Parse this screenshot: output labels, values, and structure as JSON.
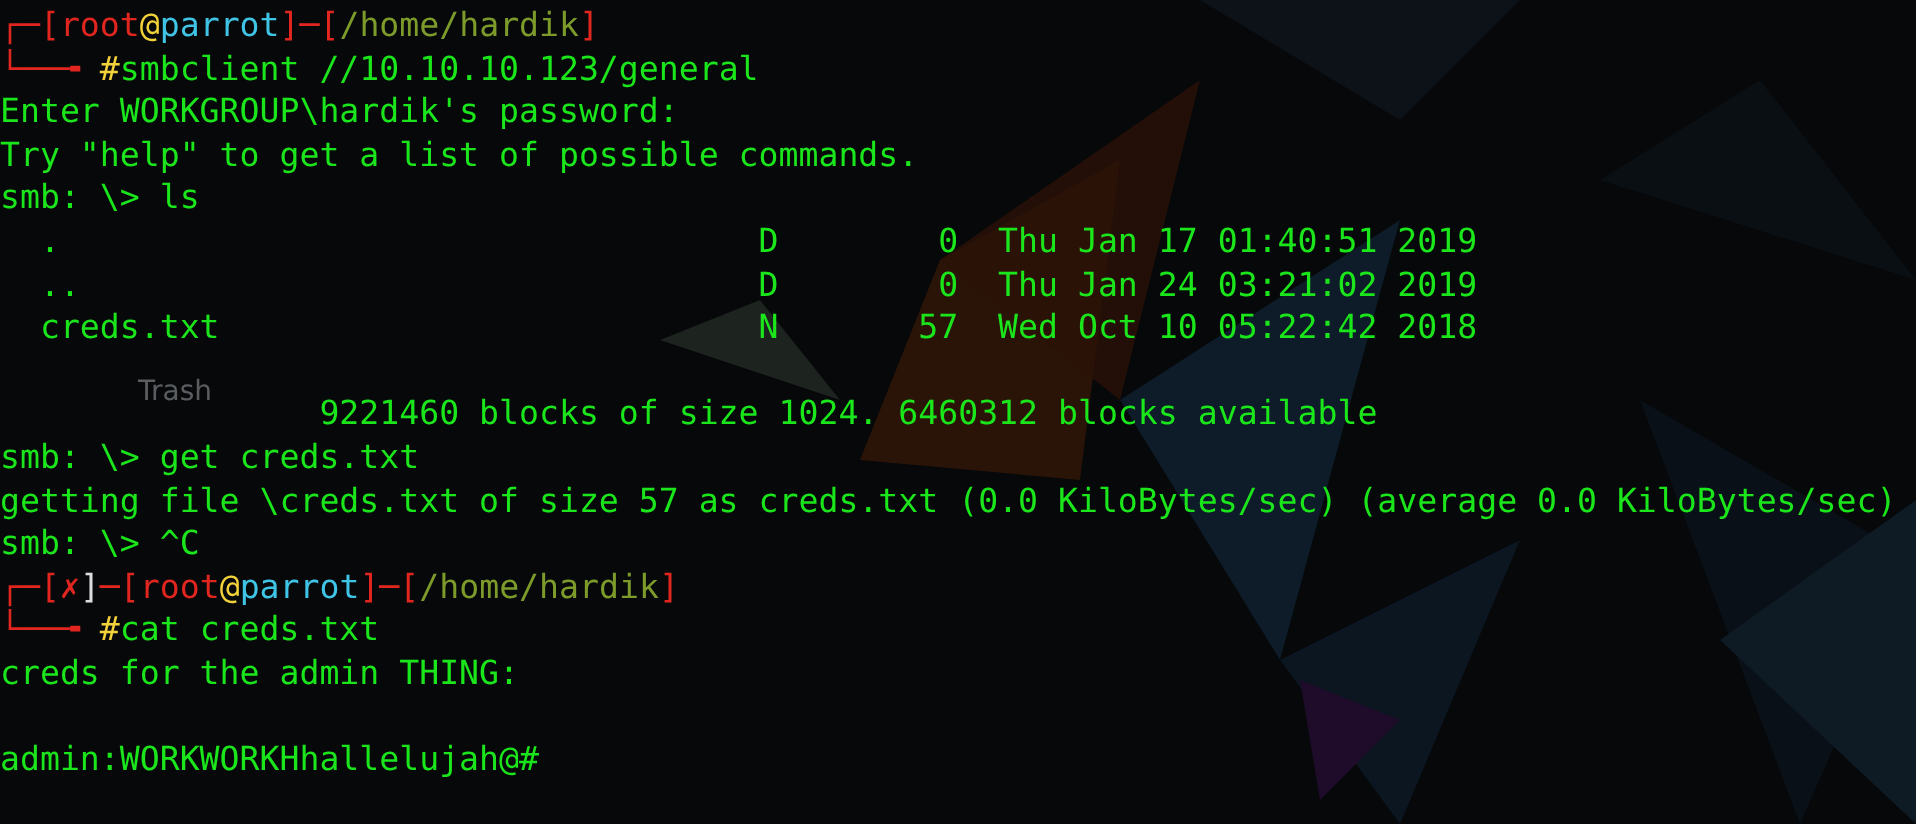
{
  "desktop_icons": [
    {
      "label": "Trash"
    }
  ],
  "terminal": {
    "lines": [
      {
        "kind": "prompt",
        "segments": [
          {
            "kind": "frame",
            "text": "┌─["
          },
          {
            "kind": "user",
            "text": "root"
          },
          {
            "kind": "at",
            "text": "@"
          },
          {
            "kind": "host",
            "text": "parrot"
          },
          {
            "kind": "frame",
            "text": "]─["
          },
          {
            "kind": "path",
            "text": "/home/hardik"
          },
          {
            "kind": "frame",
            "text": "]"
          }
        ]
      },
      {
        "kind": "command",
        "lead": "└──╼ ",
        "sigil": "#",
        "text": "smbclient //10.10.10.123/general"
      },
      {
        "kind": "output",
        "text": "Enter WORKGROUP\\hardik's password:"
      },
      {
        "kind": "output",
        "text": "Try \"help\" to get a list of possible commands."
      },
      {
        "kind": "output",
        "text": "smb: \\> ls"
      },
      {
        "kind": "output",
        "text": "  .                                   D        0  Thu Jan 17 01:40:51 2019"
      },
      {
        "kind": "output",
        "text": "  ..                                  D        0  Thu Jan 24 03:21:02 2019"
      },
      {
        "kind": "output",
        "text": "  creds.txt                           N       57  Wed Oct 10 05:22:42 2018"
      },
      {
        "kind": "blank"
      },
      {
        "kind": "output",
        "text": "                9221460 blocks of size 1024. 6460312 blocks available"
      },
      {
        "kind": "output",
        "text": "smb: \\> get creds.txt"
      },
      {
        "kind": "output",
        "text": "getting file \\creds.txt of size 57 as creds.txt (0.0 KiloBytes/sec) (average 0.0 KiloBytes/sec)"
      },
      {
        "kind": "output",
        "text": "smb: \\> ^C"
      },
      {
        "kind": "prompt",
        "segments": [
          {
            "kind": "frame",
            "text": "┌─["
          },
          {
            "kind": "error",
            "text": "✗"
          },
          {
            "kind": "plain",
            "text": "]"
          },
          {
            "kind": "frame",
            "text": "─["
          },
          {
            "kind": "user",
            "text": "root"
          },
          {
            "kind": "at",
            "text": "@"
          },
          {
            "kind": "host",
            "text": "parrot"
          },
          {
            "kind": "frame",
            "text": "]─["
          },
          {
            "kind": "path",
            "text": "/home/hardik"
          },
          {
            "kind": "frame",
            "text": "]"
          }
        ]
      },
      {
        "kind": "command",
        "lead": "└──╼ ",
        "sigil": "#",
        "text": "cat creds.txt"
      },
      {
        "kind": "output",
        "text": "creds for the admin THING:"
      },
      {
        "kind": "blank"
      },
      {
        "kind": "output",
        "text": "admin:WORKWORKHhallelujah@#"
      }
    ]
  }
}
